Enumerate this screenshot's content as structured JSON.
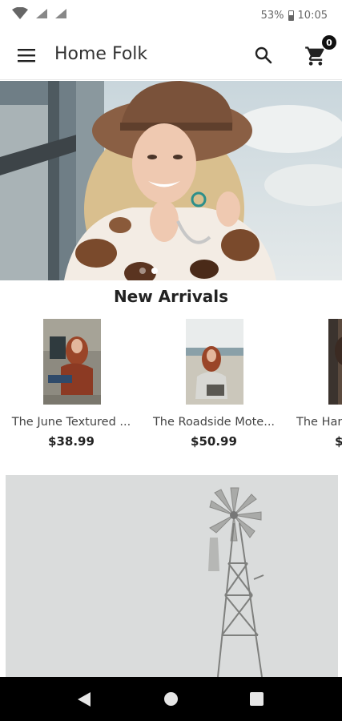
{
  "status_bar": {
    "battery": "53%",
    "time": "10:05",
    "icons": [
      "wifi-icon",
      "signal-icon",
      "signal-icon",
      "battery-icon"
    ]
  },
  "app_bar": {
    "title": "Home Folk",
    "menu_icon": "hamburger-menu-icon",
    "search_icon": "search-icon",
    "cart_icon": "shopping-cart-icon",
    "cart_count": "0"
  },
  "hero": {
    "image": "woman-in-wide-brim-hat-and-cow-print-jacket",
    "dot_count": 2,
    "active_dot": 1
  },
  "new_arrivals": {
    "title": "New Arrivals",
    "products": [
      {
        "name": "The June Textured ...",
        "price": "$38.99",
        "image": "woman-seated-in-rust-sweater"
      },
      {
        "name": "The Roadside Mote...",
        "price": "$50.99",
        "image": "woman-seated-in-field"
      },
      {
        "name": "The Han",
        "price": "$",
        "image": "woman-partial-photo"
      }
    ]
  },
  "banner2": {
    "image": "windmill-against-gray-sky"
  },
  "nav_bar": {
    "back_icon": "back-triangle-icon",
    "home_icon": "home-circle-icon",
    "recents_icon": "recents-square-icon"
  },
  "colors": {
    "background": "#ffffff",
    "badge": "#111111",
    "nav_bar": "#000000",
    "text": "#222222"
  }
}
